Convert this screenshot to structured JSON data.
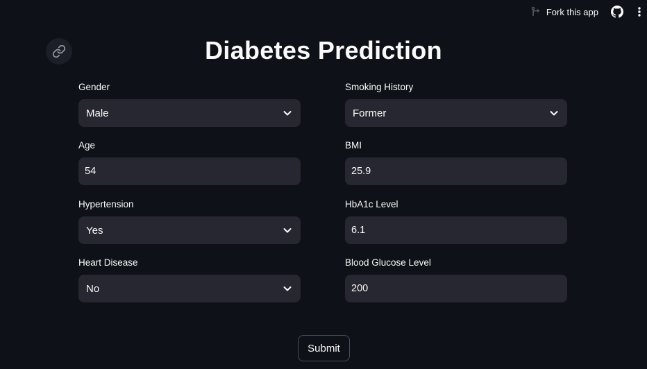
{
  "header": {
    "fork_label": "Fork this app",
    "icons": [
      "fork-icon",
      "github-icon",
      "more-vertical-icon"
    ]
  },
  "page": {
    "title": "Diabetes Prediction",
    "anchor_icon": "link-icon"
  },
  "form": {
    "gender": {
      "label": "Gender",
      "value": "Male"
    },
    "smoking_history": {
      "label": "Smoking History",
      "value": "Former"
    },
    "age": {
      "label": "Age",
      "value": "54"
    },
    "bmi": {
      "label": "BMI",
      "value": "25.9"
    },
    "hypertension": {
      "label": "Hypertension",
      "value": "Yes"
    },
    "hba1c": {
      "label": "HbA1c Level",
      "value": "6.1"
    },
    "heart_disease": {
      "label": "Heart Disease",
      "value": "No"
    },
    "blood_glucose": {
      "label": "Blood Glucose Level",
      "value": "200"
    },
    "submit_label": "Submit"
  },
  "colors": {
    "background": "#0e1117",
    "input_bg": "#262730",
    "text": "#fafafa"
  }
}
